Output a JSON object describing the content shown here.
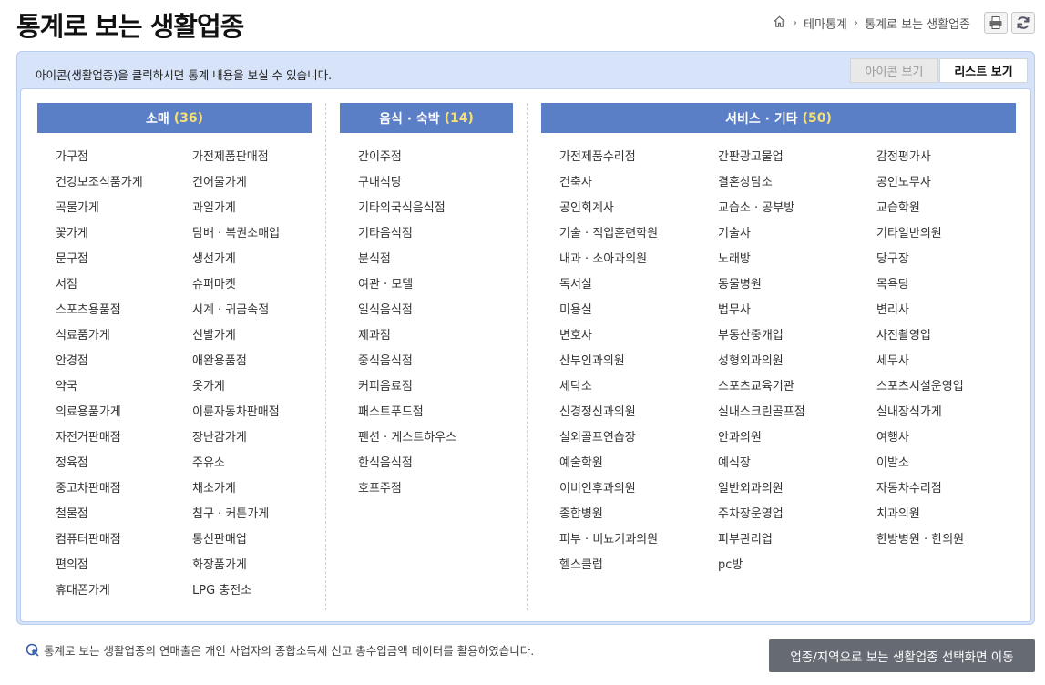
{
  "header": {
    "title": "통계로 보는 생활업종",
    "breadcrumb": [
      "테마통계",
      "통계로 보는 생활업종"
    ]
  },
  "panel": {
    "guide": "아이콘(생활업종)을 클릭하시면 통계 내용을 보실 수 있습니다.",
    "icon_view_label": "아이콘 보기",
    "list_view_label": "리스트 보기"
  },
  "categories": [
    {
      "name": "소매",
      "count": "(36)",
      "items": [
        "가구점",
        "가전제품판매점",
        "건강보조식품가게",
        "건어물가게",
        "곡물가게",
        "과일가게",
        "꽃가게",
        "담배 · 복권소매업",
        "문구점",
        "생선가게",
        "서점",
        "슈퍼마켓",
        "스포츠용품점",
        "시계 · 귀금속점",
        "식료품가게",
        "신발가게",
        "안경점",
        "애완용품점",
        "약국",
        "옷가게",
        "의료용품가게",
        "이륜자동차판매점",
        "자전거판매점",
        "장난감가게",
        "정육점",
        "주유소",
        "중고차판매점",
        "채소가게",
        "철물점",
        "침구 · 커튼가게",
        "컴퓨터판매점",
        "통신판매업",
        "편의점",
        "화장품가게",
        "휴대폰가게",
        "LPG 충전소"
      ]
    },
    {
      "name": "음식 · 숙박",
      "count": "(14)",
      "items": [
        "간이주점",
        "구내식당",
        "기타외국식음식점",
        "기타음식점",
        "분식점",
        "여관 · 모텔",
        "일식음식점",
        "제과점",
        "중식음식점",
        "커피음료점",
        "패스트푸드점",
        "펜션 · 게스트하우스",
        "한식음식점",
        "호프주점"
      ]
    },
    {
      "name": "서비스 · 기타",
      "count": "(50)",
      "items": [
        "가전제품수리점",
        "간판광고물업",
        "감정평가사",
        "건축사",
        "결혼상담소",
        "공인노무사",
        "공인회계사",
        "교습소 · 공부방",
        "교습학원",
        "기술 · 직업훈련학원",
        "기술사",
        "기타일반의원",
        "내과 · 소아과의원",
        "노래방",
        "당구장",
        "독서실",
        "동물병원",
        "목욕탕",
        "미용실",
        "법무사",
        "변리사",
        "변호사",
        "부동산중개업",
        "사진촬영업",
        "산부인과의원",
        "성형외과의원",
        "세무사",
        "세탁소",
        "스포츠교육기관",
        "스포츠시설운영업",
        "신경정신과의원",
        "실내스크린골프점",
        "실내장식가게",
        "실외골프연습장",
        "안과의원",
        "여행사",
        "예술학원",
        "예식장",
        "이발소",
        "이비인후과의원",
        "일반외과의원",
        "자동차수리점",
        "종합병원",
        "주차장운영업",
        "치과의원",
        "피부 · 비뇨기과의원",
        "피부관리업",
        "한방병원 · 한의원",
        "헬스클럽",
        "pc방"
      ]
    }
  ],
  "footer": {
    "note": "통계로 보는 생활업종의 연매출은 개인 사업자의 종합소득세 신고 총수입금액 데이터를 활용하였습니다.",
    "move_button": "업종/지역으로 보는 생활업종 선택화면 이동"
  },
  "colors": {
    "header_bar": "#5b7fc7",
    "count_text": "#f3e078",
    "panel_bg": "#d6e3f8",
    "move_button": "#666a72"
  }
}
